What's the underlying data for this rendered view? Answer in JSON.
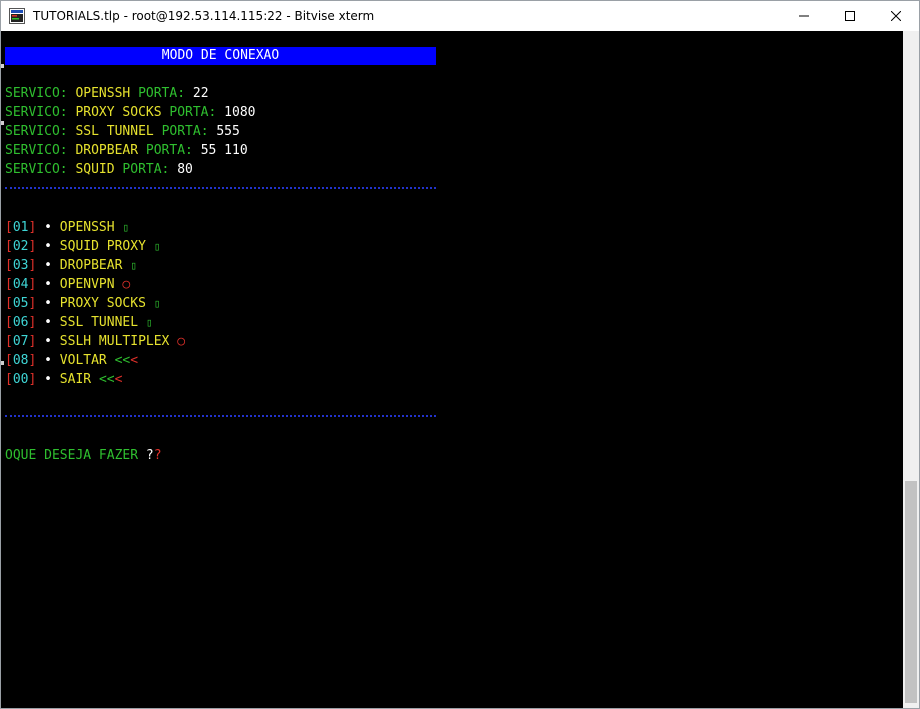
{
  "window": {
    "title": "TUTORIALS.tlp - root@192.53.114.115:22 - Bitvise xterm",
    "minimize_glyph": "—",
    "maximize_glyph": "☐",
    "close_glyph": "✕"
  },
  "terminal": {
    "banner": "MODO DE CONEXAO",
    "services": [
      {
        "label": "SERVICO:",
        "name": "OPENSSH",
        "porta_label": "PORTA:",
        "port": "22"
      },
      {
        "label": "SERVICO:",
        "name": "PROXY SOCKS",
        "porta_label": "PORTA:",
        "port": "1080"
      },
      {
        "label": "SERVICO:",
        "name": "SSL TUNNEL",
        "porta_label": "PORTA:",
        "port": "555"
      },
      {
        "label": "SERVICO:",
        "name": "DROPBEAR",
        "porta_label": "PORTA:",
        "port": "55 110"
      },
      {
        "label": "SERVICO:",
        "name": "SQUID",
        "porta_label": "PORTA:",
        "port": "80"
      }
    ],
    "menu": [
      {
        "num": "01",
        "label": "OPENSSH",
        "status": "box"
      },
      {
        "num": "02",
        "label": "SQUID PROXY",
        "status": "box"
      },
      {
        "num": "03",
        "label": "DROPBEAR",
        "status": "box"
      },
      {
        "num": "04",
        "label": "OPENVPN",
        "status": "off"
      },
      {
        "num": "05",
        "label": "PROXY SOCKS",
        "status": "box"
      },
      {
        "num": "06",
        "label": "SSL TUNNEL",
        "status": "box"
      },
      {
        "num": "07",
        "label": "SSLH MULTIPLEX",
        "status": "off"
      },
      {
        "num": "08",
        "label": "VOLTAR",
        "status": "arrow"
      },
      {
        "num": "00",
        "label": "SAIR",
        "status": "arrow"
      }
    ],
    "bullet": "•",
    "box_glyph": "▯",
    "off_glyph": "○",
    "arrow_glyph": "<<<",
    "prompt": "OQUE DESEJA FAZER",
    "prompt_marks": "??"
  },
  "colors": {
    "banner_bg": "#0000ff",
    "green": "#2fbf2f",
    "yellow": "#e6e22e",
    "cyan": "#3fd6d6",
    "red": "#e0302a",
    "separator": "#2233cc"
  }
}
